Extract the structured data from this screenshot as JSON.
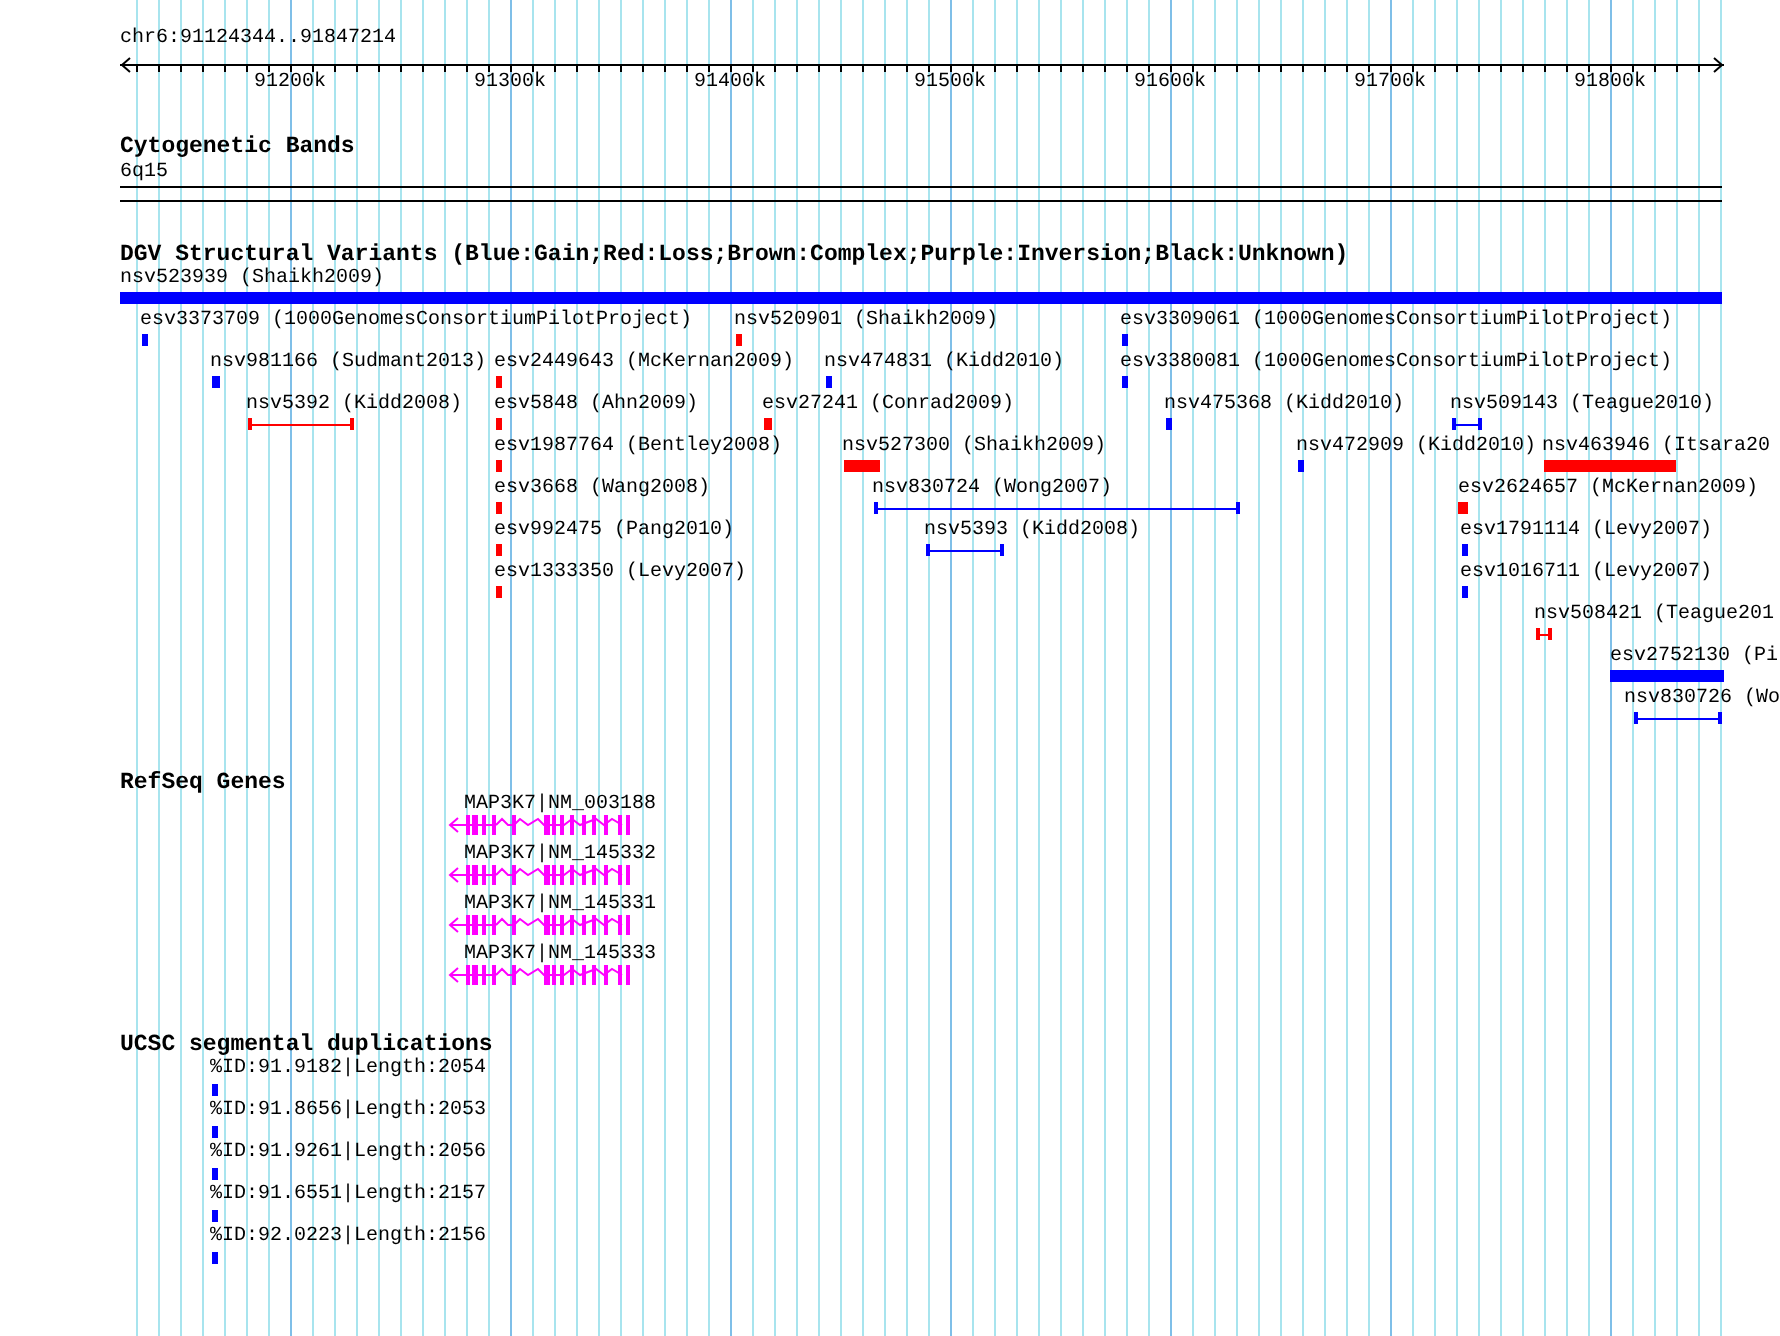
{
  "ruler": {
    "range": "chr6:91124344..91847214",
    "ticks": [
      "91200k",
      "91300k",
      "91400k",
      "91500k",
      "91600k",
      "91700k",
      "91800k"
    ]
  },
  "cytogenetic_bands": {
    "title": "Cytogenetic Bands",
    "band": "6q15"
  },
  "structural_variants": {
    "title": "DGV Structural Variants (Blue:Gain;Red:Loss;Brown:Complex;Purple:Inversion;Black:Unknown)",
    "features": [
      {
        "label": "nsv523939 (Shaikh2009)",
        "color": "#0000ff",
        "kind": "block"
      },
      {
        "label": "esv3373709 (1000GenomesConsortiumPilotProject)",
        "color": "#0000ff",
        "kind": "block"
      },
      {
        "label": "nsv520901 (Shaikh2009)",
        "color": "#ff0000",
        "kind": "block"
      },
      {
        "label": "esv3309061 (1000GenomesConsortiumPilotProject)",
        "color": "#0000ff",
        "kind": "block"
      },
      {
        "label": "nsv981166 (Sudmant2013)",
        "color": "#0000ff",
        "kind": "block"
      },
      {
        "label": "esv2449643 (McKernan2009)",
        "color": "#ff0000",
        "kind": "block"
      },
      {
        "label": "nsv474831 (Kidd2010)",
        "color": "#0000ff",
        "kind": "block"
      },
      {
        "label": "esv3380081 (1000GenomesConsortiumPilotProject)",
        "color": "#0000ff",
        "kind": "block"
      },
      {
        "label": "nsv5392 (Kidd2008)",
        "color": "#ff0000",
        "kind": "span"
      },
      {
        "label": "esv5848 (Ahn2009)",
        "color": "#ff0000",
        "kind": "block"
      },
      {
        "label": "esv27241 (Conrad2009)",
        "color": "#ff0000",
        "kind": "block"
      },
      {
        "label": "nsv475368 (Kidd2010)",
        "color": "#0000ff",
        "kind": "block"
      },
      {
        "label": "nsv509143 (Teague2010)",
        "color": "#0000ff",
        "kind": "span"
      },
      {
        "label": "esv1987764 (Bentley2008)",
        "color": "#ff0000",
        "kind": "block"
      },
      {
        "label": "nsv527300 (Shaikh2009)",
        "color": "#ff0000",
        "kind": "block"
      },
      {
        "label": "nsv472909 (Kidd2010)",
        "color": "#0000ff",
        "kind": "block"
      },
      {
        "label": "nsv463946 (Itsara20",
        "color": "#ff0000",
        "kind": "block"
      },
      {
        "label": "esv3668 (Wang2008)",
        "color": "#ff0000",
        "kind": "block"
      },
      {
        "label": "nsv830724 (Wong2007)",
        "color": "#0000ff",
        "kind": "span"
      },
      {
        "label": "esv2624657 (McKernan2009)",
        "color": "#ff0000",
        "kind": "block"
      },
      {
        "label": "esv992475 (Pang2010)",
        "color": "#ff0000",
        "kind": "block"
      },
      {
        "label": "nsv5393 (Kidd2008)",
        "color": "#0000ff",
        "kind": "span"
      },
      {
        "label": "esv1791114 (Levy2007)",
        "color": "#0000ff",
        "kind": "block"
      },
      {
        "label": "esv1333350 (Levy2007)",
        "color": "#ff0000",
        "kind": "block"
      },
      {
        "label": "esv1016711 (Levy2007)",
        "color": "#0000ff",
        "kind": "block"
      },
      {
        "label": "nsv508421 (Teague201",
        "color": "#ff0000",
        "kind": "span"
      },
      {
        "label": "esv2752130 (Pi",
        "color": "#0000ff",
        "kind": "block"
      },
      {
        "label": "nsv830726 (Wo",
        "color": "#0000ff",
        "kind": "span"
      }
    ]
  },
  "refseq_genes": {
    "title": "RefSeq Genes",
    "genes": [
      "MAP3K7|NM_003188",
      "MAP3K7|NM_145332",
      "MAP3K7|NM_145331",
      "MAP3K7|NM_145333"
    ]
  },
  "segmental_duplications": {
    "title": "UCSC segmental duplications",
    "items": [
      "%ID:91.9182|Length:2054",
      "%ID:91.8656|Length:2053",
      "%ID:91.9261|Length:2056",
      "%ID:91.6551|Length:2157",
      "%ID:92.0223|Length:2156"
    ]
  }
}
